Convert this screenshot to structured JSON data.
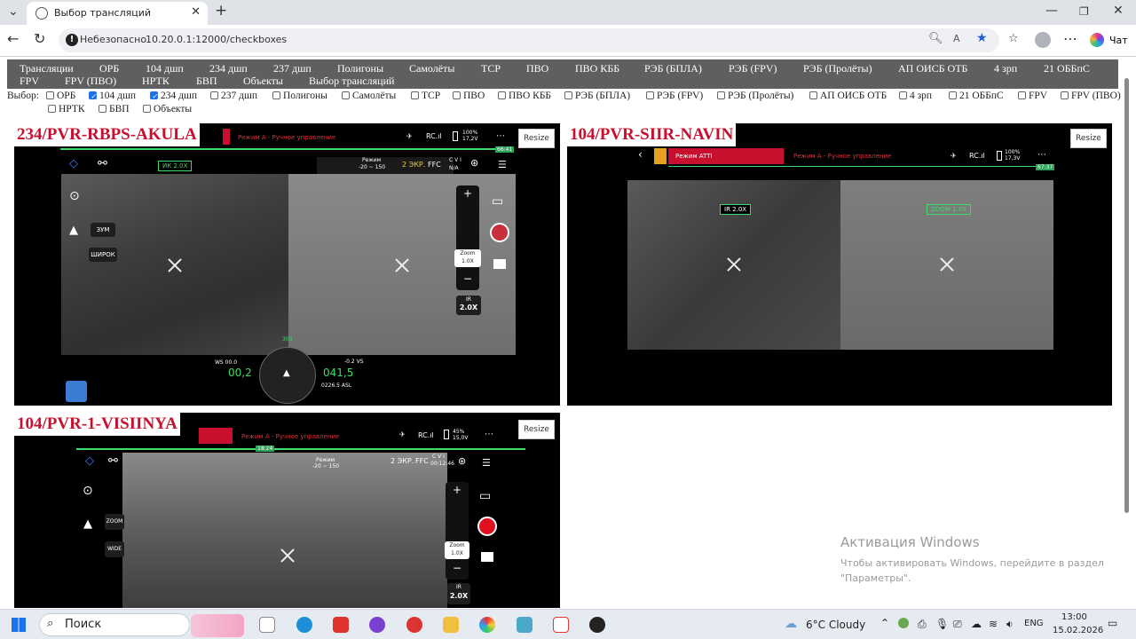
{
  "browser": {
    "tab_title": "Выбор трансляций",
    "security_label": "Небезопасно",
    "url": "10.20.0.1:12000/checkboxes",
    "chat_label": "Чат"
  },
  "menu": {
    "items": [
      "Трансляции",
      "ОРБ",
      "104 дшп",
      "234 дшп",
      "237 дшп",
      "Полигоны",
      "Самолёты",
      "ТСР",
      "ПВО",
      "ПВО КББ",
      "РЭБ (БПЛА)",
      "РЭБ (FPV)",
      "РЭБ (Пролёты)",
      "АП ОИСБ ОТБ",
      "4 зрп",
      "21 ОББпС",
      "FPV",
      "FPV (ПВО)",
      "НРТК",
      "БВП",
      "Объекты",
      "Выбор трансляций"
    ]
  },
  "filter": {
    "label": "Выбор:",
    "options": [
      {
        "label": "ОРБ",
        "checked": false
      },
      {
        "label": "104 дшп",
        "checked": true
      },
      {
        "label": "234 дшп",
        "checked": true
      },
      {
        "label": "237 дшп",
        "checked": false
      },
      {
        "label": "Полигоны",
        "checked": false
      },
      {
        "label": "Самолёты",
        "checked": false
      },
      {
        "label": "ТСР",
        "checked": false
      },
      {
        "label": "ПВО",
        "checked": false
      },
      {
        "label": "ПВО КББ",
        "checked": false
      },
      {
        "label": "РЭБ (БПЛА)",
        "checked": false
      },
      {
        "label": "РЭБ (FPV)",
        "checked": false
      },
      {
        "label": "РЭБ (Пролёты)",
        "checked": false
      },
      {
        "label": "АП ОИСБ ОТБ",
        "checked": false
      },
      {
        "label": "4 зрп",
        "checked": false
      },
      {
        "label": "21 ОББпС",
        "checked": false
      },
      {
        "label": "FPV",
        "checked": false
      },
      {
        "label": "FPV (ПВО)",
        "checked": false
      },
      {
        "label": "НРТК",
        "checked": false
      },
      {
        "label": "БВП",
        "checked": false
      },
      {
        "label": "Объекты",
        "checked": false
      }
    ]
  },
  "streams": [
    {
      "title": "234/PVR-RBPS-AKULA",
      "resize": "Resize",
      "mode": "Режим A - Ручное управление",
      "rc": "RC.ıl",
      "battery": "100%\n17,2V",
      "range_top": "66:41",
      "zoom_tag": "ИК 2.0X",
      "ekr": "2 ЭКР.",
      "ffc": "FFC",
      "cvi": "C V I",
      "na": "N/A",
      "regime": "Режим",
      "regime_range": "-20 ~ 150",
      "zum": "ЗУМ",
      "shirok": "ШИРОК",
      "zoom_lbl": "Zoom",
      "zoom_val": "1.0X",
      "ir_lbl": "IR",
      "ir_val": "2.0X",
      "ws": "WS 00.0",
      "speed": "00,2",
      "alt": "041,5",
      "vs": "-0.2 VS",
      "asl": "0226.5 ASL",
      "heading": "303"
    },
    {
      "title": "104/PVR-SIIR-NAVIN",
      "resize": "Resize",
      "mode_box": "Режим ATTI",
      "mode": "Режим A - Ручное управление",
      "rc": "RC.ıl",
      "battery": "100%\n17,3V",
      "range_top": "67:37",
      "zoom_tag_left": "IR 2.0X",
      "zoom_tag_right": "ZOOM 1.0X"
    },
    {
      "title": "104/PVR-1-VISIINYA",
      "resize": "Resize",
      "mode": "Режим A - Ручное управление",
      "rc": "RC.ıl",
      "battery": "45%\n15,0V",
      "range_top": "18:24",
      "ekr": "2 ЭКР.",
      "ffc": "FFC",
      "cvi": "C V I",
      "time": "00:12:46",
      "regime": "Режим",
      "regime_range": "-20 ~ 150",
      "zoom_btn": "ZOOM",
      "wide_btn": "WIDE",
      "zoom_lbl": "Zoom",
      "zoom_val": "1.0X",
      "ir_lbl": "IR",
      "ir_val": "2.0X"
    }
  ],
  "watermark": {
    "title": "Активация Windows",
    "line1": "Чтобы активировать Windows, перейдите в раздел",
    "line2": "\"Параметры\"."
  },
  "taskbar": {
    "search": "Поиск",
    "weather": "6°C  Cloudy",
    "lang": "ENG",
    "time": "13:00",
    "date": "15.02.2026"
  }
}
